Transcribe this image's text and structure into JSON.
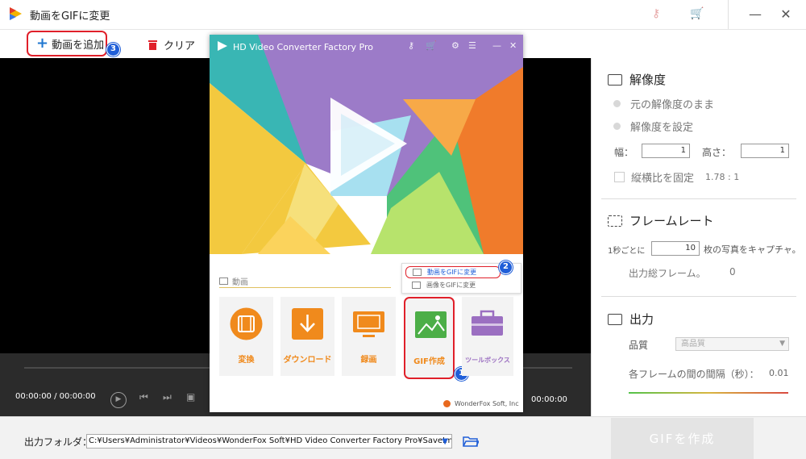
{
  "window": {
    "title": "動画をGIFに変更",
    "minimize": "—",
    "close": "✕"
  },
  "toolbar": {
    "add_label": "動画を追加",
    "clear_label": "クリア"
  },
  "badges": {
    "one": "1",
    "two": "2",
    "three": "3"
  },
  "player": {
    "time_current": "00:00:00  /  00:00:00",
    "time_end": "00:00:00"
  },
  "resolution": {
    "title": "解像度",
    "option_keep": "元の解像度のまま",
    "option_set": "解像度を設定",
    "width_label": "幅：",
    "width_value": "1",
    "height_label": "高さ：",
    "height_value": "1",
    "aspect_label": "縦横比を固定",
    "aspect_value": "1.78 : 1"
  },
  "framerate": {
    "title": "フレームレート",
    "prefix": "1秒ごとに",
    "value": "10",
    "suffix": "枚の写真をキャプチャ。",
    "total_label": "出力総フレーム。",
    "total_value": "0"
  },
  "output": {
    "title": "出力",
    "quality_label": "品質",
    "quality_value": "高品質",
    "interval_label": "各フレームの間の間隔（秒）：",
    "interval_value": "0.01"
  },
  "bottom": {
    "folder_label": "出力フォルダ：",
    "path": "C:¥Users¥Administrator¥Videos¥WonderFox Soft¥HD Video Converter Factory Pro¥SaveImage¥",
    "create_label": "GIFを作成"
  },
  "inner": {
    "title": "HD Video Converter Factory Pro",
    "category": "動画",
    "tiles": [
      {
        "label": "変換",
        "color": "#f08a1c"
      },
      {
        "label": "ダウンロード",
        "color": "#f08a1c"
      },
      {
        "label": "録画",
        "color": "#f08a1c"
      },
      {
        "label": "GIF作成",
        "color": "#f08a1c"
      },
      {
        "label": "ツールボックス",
        "color": "#9b6fc1"
      }
    ],
    "menu": {
      "video_to_gif": "動画をGIFに変更",
      "image_to_gif": "画像をGIFに変更"
    },
    "brand": "WonderFox Soft, Inc"
  }
}
